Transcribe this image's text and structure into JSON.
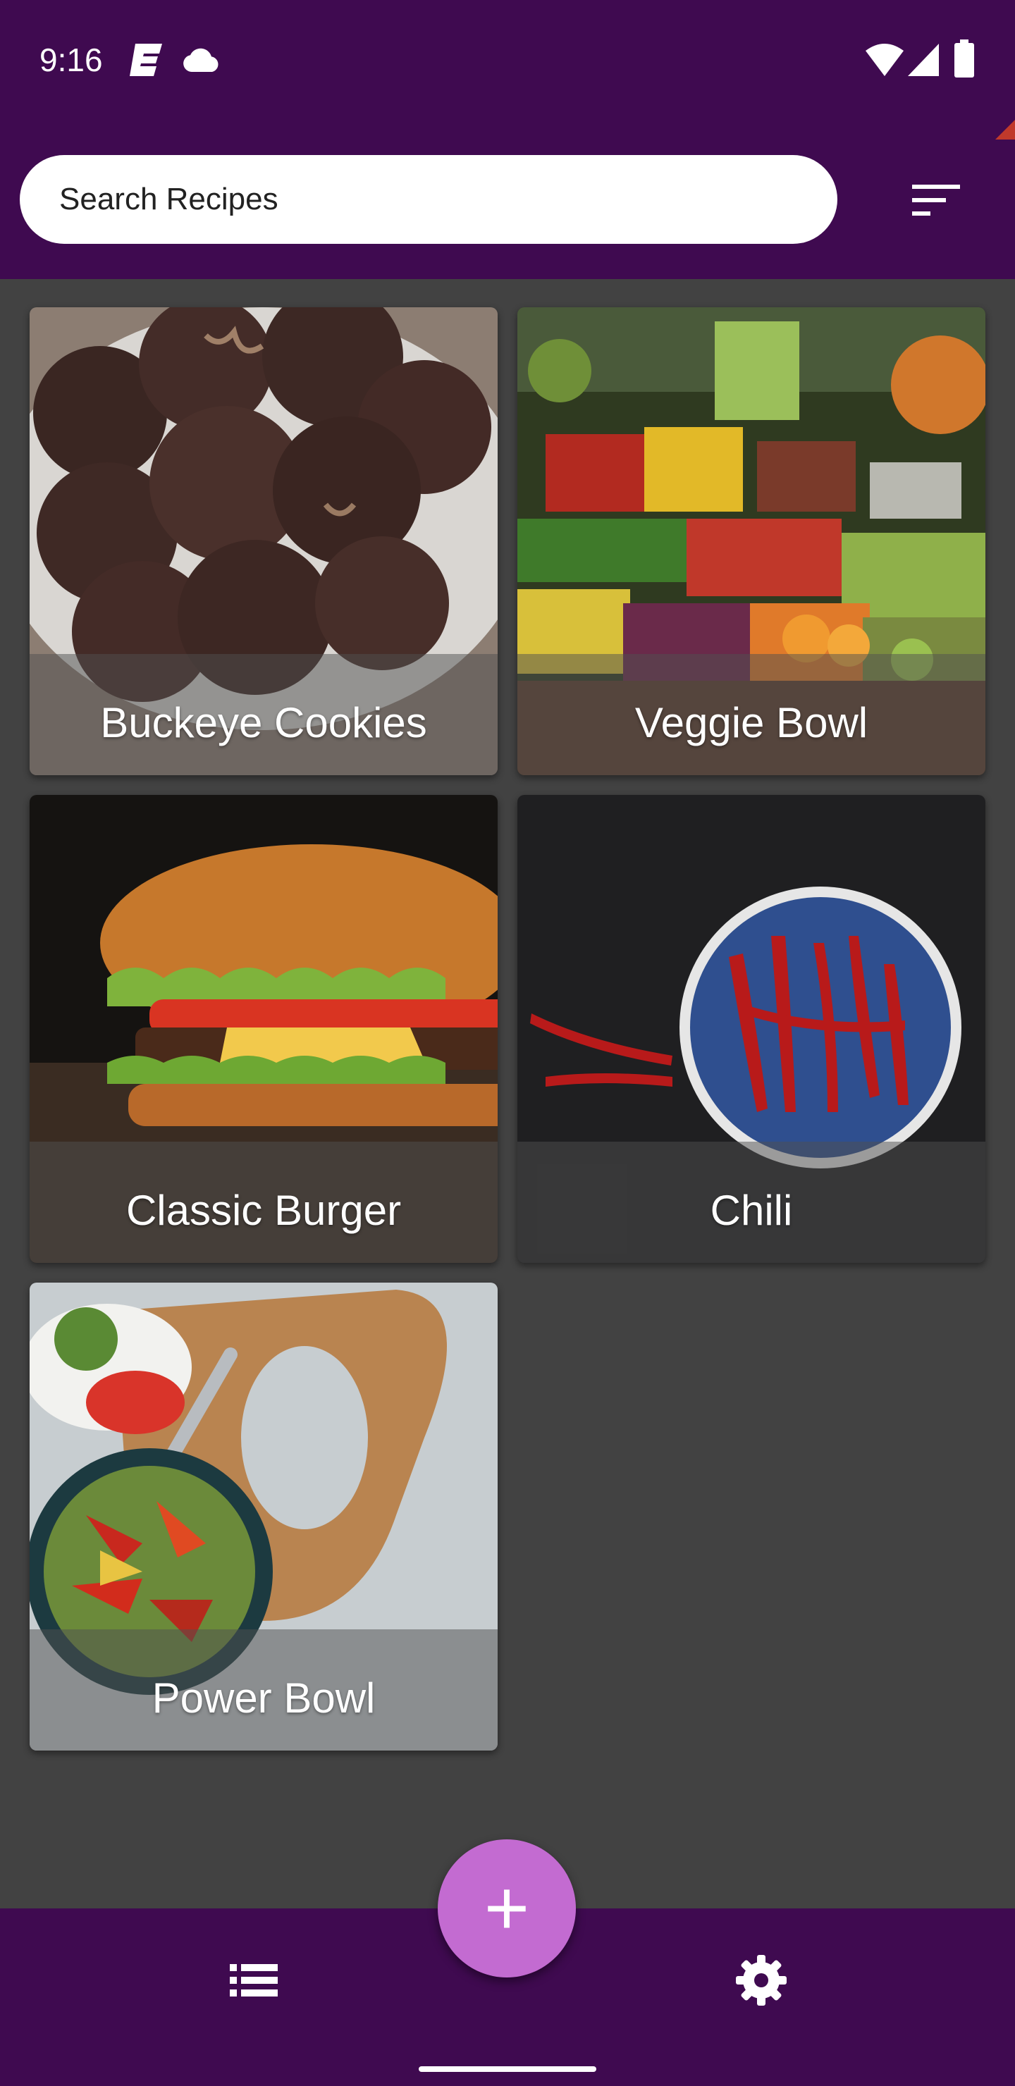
{
  "status_bar": {
    "time": "9:16",
    "icons": [
      "notification-app-icon",
      "cloud-icon",
      "wifi-icon",
      "cellular-signal-icon",
      "battery-icon"
    ]
  },
  "search": {
    "placeholder": "Search Recipes"
  },
  "toolbar": {
    "sort_icon": "sort-lines-icon"
  },
  "recipes": [
    {
      "title": "Buckeye Cookies"
    },
    {
      "title": "Veggie Bowl"
    },
    {
      "title": "Classic Burger"
    },
    {
      "title": "Chili"
    },
    {
      "title": "Power Bowl"
    }
  ],
  "bottom_nav": {
    "fab_label": "+",
    "left_icon": "list-icon",
    "right_icon": "gear-icon"
  },
  "colors": {
    "app_bar": "#3f0a50",
    "background": "#424242",
    "fab": "#c36bd1",
    "search_field": "#ffffff",
    "accent_corner": "#c0392b"
  }
}
